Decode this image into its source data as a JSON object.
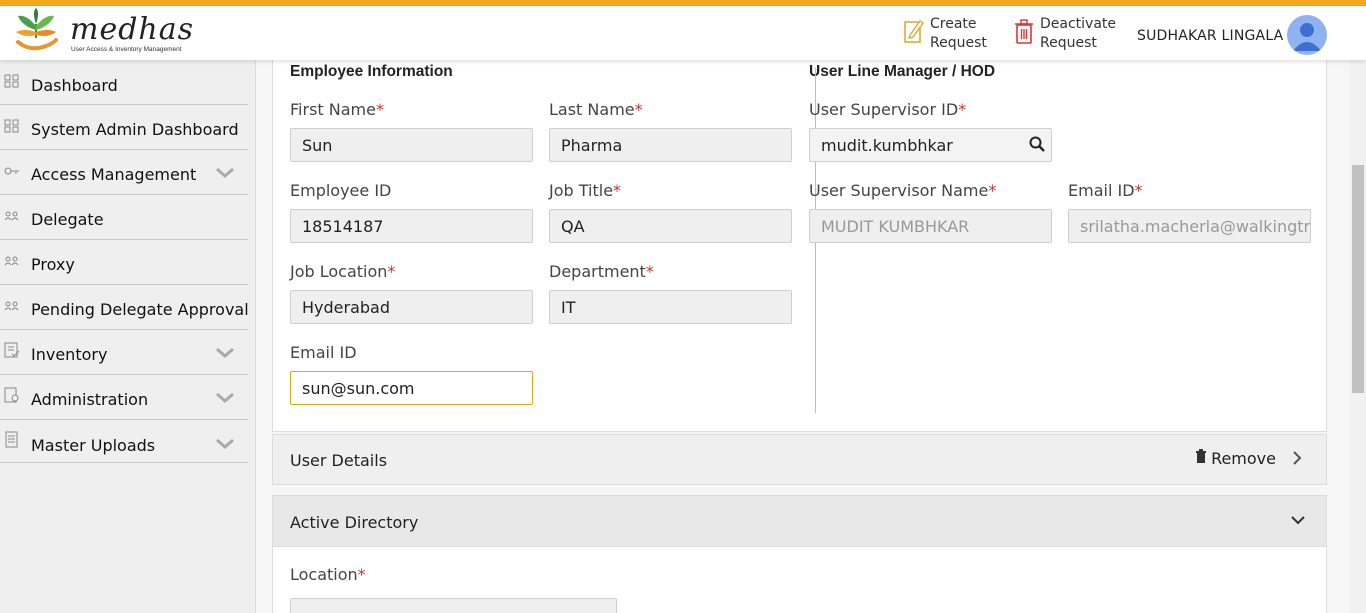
{
  "brand": {
    "name": "medhas",
    "tagline": "User Access & Inventory Management"
  },
  "header": {
    "create_request": [
      "Create",
      "Request"
    ],
    "deactivate_request": [
      "Deactivate",
      "Request"
    ],
    "user_name": "SUDHAKAR LINGALA"
  },
  "sidebar": {
    "items": [
      {
        "label": "Dashboard",
        "icon": "grid-icon",
        "expandable": false
      },
      {
        "label": "System Admin Dashboard",
        "icon": "grid-icon",
        "expandable": false
      },
      {
        "label": "Access Management",
        "icon": "key-icon",
        "expandable": true
      },
      {
        "label": "Delegate",
        "icon": "users-icon",
        "expandable": false
      },
      {
        "label": "Proxy",
        "icon": "users-icon",
        "expandable": false
      },
      {
        "label": "Pending Delegate Approval",
        "icon": "users-icon",
        "expandable": false
      },
      {
        "label": "Inventory",
        "icon": "checklist-icon",
        "expandable": true
      },
      {
        "label": "Administration",
        "icon": "document-gear-icon",
        "expandable": true
      },
      {
        "label": "Master Uploads",
        "icon": "document-icon",
        "expandable": true
      }
    ]
  },
  "employee": {
    "title": "Employee Information",
    "first_name": {
      "label": "First Name",
      "value": "Sun"
    },
    "last_name": {
      "label": "Last Name",
      "value": "Pharma"
    },
    "employee_id": {
      "label": "Employee ID",
      "value": "18514187"
    },
    "job_title": {
      "label": "Job Title",
      "value": "QA"
    },
    "job_location": {
      "label": "Job Location",
      "value": "Hyderabad"
    },
    "department": {
      "label": "Department",
      "value": "IT"
    },
    "email": {
      "label": "Email ID",
      "value": "sun@sun.com"
    }
  },
  "manager": {
    "title": "User Line Manager / HOD",
    "supervisor_id": {
      "label": "User Supervisor ID",
      "value": "mudit.kumbhkar"
    },
    "supervisor_name": {
      "label": "User Supervisor Name",
      "value": "MUDIT KUMBHKAR"
    },
    "email": {
      "label": "Email ID",
      "value": "srilatha.macherla@walkingtre"
    }
  },
  "user_details": {
    "title": "User Details",
    "remove_label": "Remove"
  },
  "active_directory": {
    "title": "Active Directory",
    "location_label": "Location"
  },
  "colors": {
    "accent": "#f4a81e",
    "required": "#d32f2f",
    "focus_border": "#e3a61c"
  }
}
